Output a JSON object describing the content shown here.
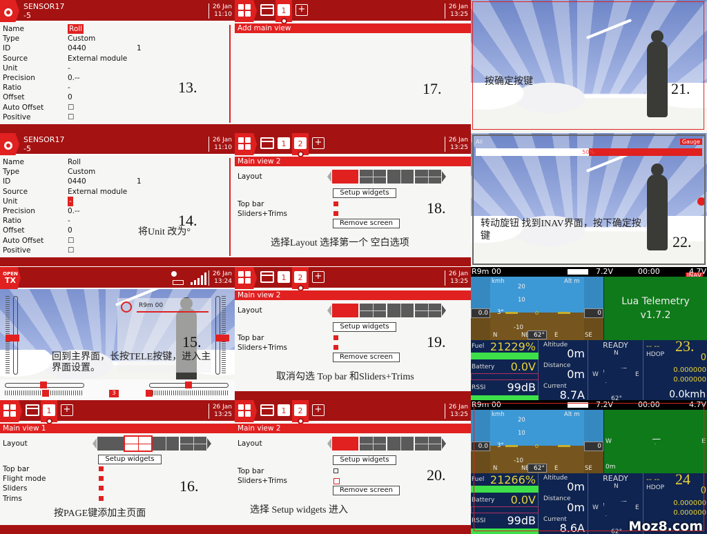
{
  "sensor_panels": [
    {
      "step": "13.",
      "header": {
        "title": "SENSOR17",
        "subtitle": "-5",
        "date": "26 Jan",
        "time": "11:10"
      },
      "selected_field": "Name",
      "fields": [
        {
          "label": "Name",
          "value": "Roll",
          "extra": ""
        },
        {
          "label": "Type",
          "value": "Custom",
          "extra": ""
        },
        {
          "label": "ID",
          "value": "0440",
          "extra": "1"
        },
        {
          "label": "Source",
          "value": "External module",
          "extra": ""
        },
        {
          "label": "Unit",
          "value": "-",
          "extra": ""
        },
        {
          "label": "Precision",
          "value": "0.--",
          "extra": ""
        },
        {
          "label": "Ratio",
          "value": "-",
          "extra": ""
        },
        {
          "label": "Offset",
          "value": "0",
          "extra": ""
        },
        {
          "label": "Auto Offset",
          "value": "☐",
          "extra": ""
        },
        {
          "label": "Positive",
          "value": "☐",
          "extra": ""
        }
      ],
      "caption": ""
    },
    {
      "step": "14.",
      "header": {
        "title": "SENSOR17",
        "subtitle": "-5",
        "date": "26 Jan",
        "time": "11:10"
      },
      "selected_field": "Unit",
      "fields": [
        {
          "label": "Name",
          "value": "Roll",
          "extra": ""
        },
        {
          "label": "Type",
          "value": "Custom",
          "extra": ""
        },
        {
          "label": "ID",
          "value": "0440",
          "extra": "1"
        },
        {
          "label": "Source",
          "value": "External module",
          "extra": ""
        },
        {
          "label": "Unit",
          "value": "-",
          "extra": ""
        },
        {
          "label": "Precision",
          "value": "0.--",
          "extra": ""
        },
        {
          "label": "Ratio",
          "value": "-",
          "extra": ""
        },
        {
          "label": "Offset",
          "value": "0",
          "extra": ""
        },
        {
          "label": "Auto Offset",
          "value": "☐",
          "extra": ""
        },
        {
          "label": "Positive",
          "value": "☐",
          "extra": ""
        }
      ],
      "caption": "将Unit 改为°"
    }
  ],
  "home_panel": {
    "step": "15.",
    "logo": "OPEN TX",
    "date": "26 Jan",
    "time": "13:24",
    "model": "R9m  00",
    "trim_value": "3",
    "caption": "回到主界面，长按TELE按键，进入主界面设置。",
    "icons": [
      "sd-card-icon",
      "battery-icon",
      "signal-bars-icon"
    ]
  },
  "add_view_panel": {
    "step": "17.",
    "tabs": [
      "1"
    ],
    "date": "26 Jan",
    "time": "13:25",
    "title": "Add main view"
  },
  "view_panels": [
    {
      "step": "16.",
      "tabs": [
        "1"
      ],
      "active_tab": "1",
      "date": "26 Jan",
      "time": "13:25",
      "title": "Main view 1",
      "layout_label": "Layout",
      "selected_layout": 2,
      "setup_label": "Setup widgets",
      "remove_label": "",
      "options": [
        {
          "label": "Top bar",
          "checked": true
        },
        {
          "label": "Flight mode",
          "checked": true
        },
        {
          "label": "Sliders",
          "checked": true
        },
        {
          "label": "Trims",
          "checked": true
        }
      ],
      "caption": "按PAGE键添加主页面"
    },
    {
      "step": "18.",
      "tabs": [
        "1",
        "2"
      ],
      "active_tab": "2",
      "date": "26 Jan",
      "time": "13:25",
      "title": "Main view 2",
      "layout_label": "Layout",
      "selected_layout": 1,
      "setup_label": "Setup widgets",
      "remove_label": "Remove screen",
      "options": [
        {
          "label": "Top bar",
          "checked": true
        },
        {
          "label": "Sliders+Trims",
          "checked": true
        }
      ],
      "caption": "选择Layout 选择第一个 空白选项"
    },
    {
      "step": "19.",
      "tabs": [
        "1",
        "2"
      ],
      "active_tab": "2",
      "date": "26 Jan",
      "time": "13:25",
      "title": "Main view 2",
      "layout_label": "Layout",
      "selected_layout": 1,
      "setup_label": "Setup widgets",
      "remove_label": "Remove screen",
      "options": [
        {
          "label": "Top bar",
          "checked": true
        },
        {
          "label": "Sliders+Trims",
          "checked": true
        }
      ],
      "caption": "取消勾选 Top bar 和Sliders+Trims"
    },
    {
      "step": "20.",
      "tabs": [
        "1",
        "2"
      ],
      "active_tab": "2",
      "date": "26 Jan",
      "time": "13:25",
      "title": "Main view 2",
      "layout_label": "Layout",
      "selected_layout": 1,
      "setup_label": "Setup widgets",
      "remove_label": "Remove screen",
      "options": [
        {
          "label": "Top bar",
          "checked": false
        },
        {
          "label": "Sliders+Trims",
          "checked": false
        }
      ],
      "caption": "选择 Setup widgets 进入"
    }
  ],
  "sky_panels": [
    {
      "step": "21.",
      "caption": "按确定按键",
      "gauge": null
    },
    {
      "step": "22.",
      "caption": "转动旋钮 找到INAV界面，按下确定按键",
      "gauge": {
        "source": "Ail",
        "name": "Gauge",
        "percent_label": "50%",
        "percent": 50
      }
    }
  ],
  "telemetry_panels": [
    {
      "step": "23.",
      "model": "R9m  00",
      "tx_voltage": "7.2V",
      "timer": "00:00",
      "rx_voltage": "4.7V",
      "badge": "INAV",
      "speed_unit": "kmh",
      "alt_unit": "Alt m",
      "speed": "0.0",
      "alt": "0",
      "pitch": "3°",
      "heading": "62°",
      "compass_ticks": [
        "N",
        "NE",
        "E",
        "SE"
      ],
      "ladder": [
        "20",
        "10",
        "-10"
      ],
      "green_title": "Lua Telemetry",
      "green_version": "v1.7.2",
      "fuel_label": "Fuel",
      "fuel": "21229%",
      "battery_label": "Battery",
      "battery": "0.0V",
      "rssi_label": "RSSI",
      "rssi": "99dB",
      "altitude_label": "Altitude",
      "altitude": "0m",
      "distance_label": "Distance",
      "distance": "0m",
      "current_label": "Current",
      "current": "8.7A",
      "status": "READY",
      "compass": {
        "n": "N",
        "w": "W",
        "e": "E",
        "heading": "62°"
      },
      "gps_sats": "-- --",
      "hdop_label": "HDOP",
      "gps_value": "0",
      "lat": "0.000000",
      "lon": "0.000000",
      "gspeed": "0.0kmh"
    },
    {
      "step": "24",
      "model": "R9m  00",
      "tx_voltage": "7.2V",
      "timer": "00:00",
      "rx_voltage": "4.7V",
      "badge": "",
      "speed_unit": "kmh",
      "alt_unit": "Alt m",
      "speed": "0.0",
      "alt": "0",
      "pitch": "3°",
      "heading": "62°",
      "compass_ticks": [
        "N",
        "NE",
        "E",
        "SE"
      ],
      "ladder": [
        "20",
        "10",
        "-10"
      ],
      "green_title": "",
      "green_version": "",
      "map_w": "W",
      "map_e": "E",
      "map_scale": "0m",
      "fuel_label": "Fuel",
      "fuel": "21266%",
      "battery_label": "Battery",
      "battery": "0.0V",
      "rssi_label": "RSSI",
      "rssi": "99dB",
      "altitude_label": "Altitude",
      "altitude": "0m",
      "distance_label": "Distance",
      "distance": "0m",
      "current_label": "Current",
      "current": "8.6A",
      "status": "READY",
      "compass": {
        "n": "N",
        "w": "W",
        "e": "E",
        "heading": "62°"
      },
      "gps_sats": "-- --",
      "hdop_label": "HDOP",
      "gps_value": "0",
      "lat": "0.000000",
      "lon": "0.000000",
      "gspeed": ""
    }
  ],
  "watermark": "Moz8.com",
  "colors": {
    "header_red": "#a51212",
    "accent_red": "#e12020",
    "telemetry_navy": "#0f2450",
    "telemetry_yellow": "#e9d33a",
    "map_green": "#0f7a1a"
  }
}
